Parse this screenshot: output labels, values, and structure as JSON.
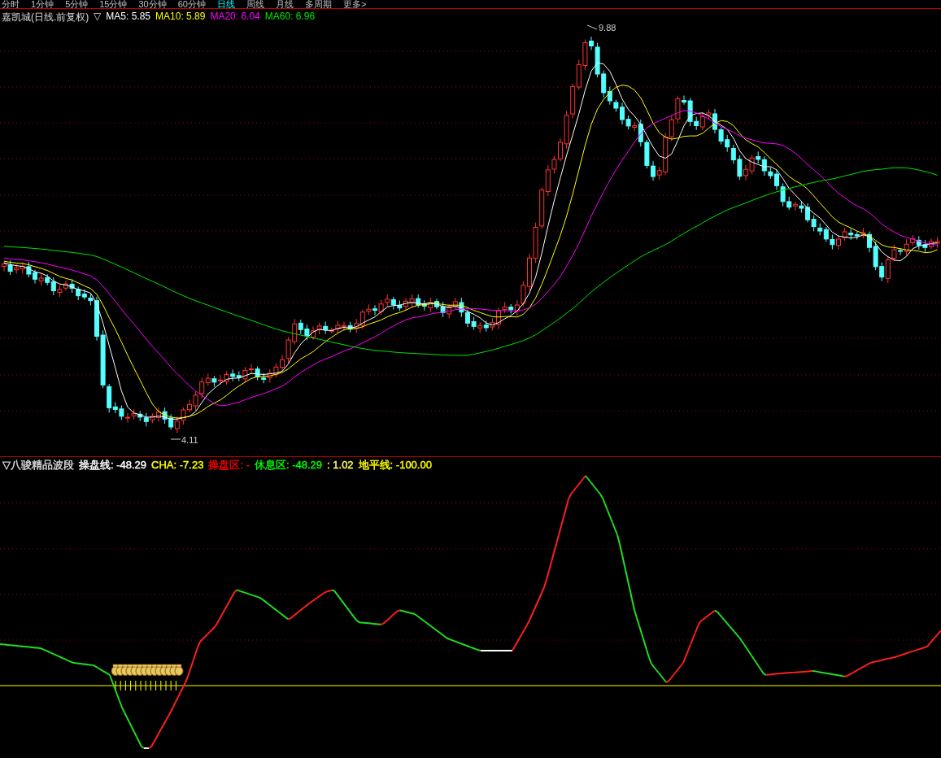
{
  "menu": {
    "items": [
      {
        "label": "分时",
        "selected": false
      },
      {
        "label": "1分钟",
        "selected": false
      },
      {
        "label": "5分钟",
        "selected": false
      },
      {
        "label": "15分钟",
        "selected": false
      },
      {
        "label": "30分钟",
        "selected": false
      },
      {
        "label": "60分钟",
        "selected": false
      },
      {
        "label": "日线",
        "selected": true
      },
      {
        "label": "周线",
        "selected": false
      },
      {
        "label": "月线",
        "selected": false
      },
      {
        "label": "多周期",
        "selected": false
      },
      {
        "label": "更多>",
        "selected": false
      }
    ]
  },
  "price_panel": {
    "title": "嘉凯城(日线.前复权)",
    "toggle": "▽",
    "legend": [
      {
        "label": "MA5: 5.85",
        "color": "#ffffff"
      },
      {
        "label": "MA10: 5.89",
        "color": "#ffff00"
      },
      {
        "label": "MA20: 6.04",
        "color": "#ff00ff"
      },
      {
        "label": "MA60: 6.96",
        "color": "#00e600"
      }
    ],
    "high_label": "9.88",
    "low_label": "4.11"
  },
  "indicator_panel": {
    "toggle": "▽",
    "title": "八骏精品波段",
    "legend": [
      {
        "label": "操盘线: -48.29",
        "color": "#ffffff"
      },
      {
        "label": "CHA: -7.23",
        "color": "#ffff00"
      },
      {
        "label": "操盘区: -",
        "color": "#ff0000"
      },
      {
        "label": "休息区: -48.29",
        "color": "#00ff00"
      },
      {
        "label": ": 1.02",
        "color": "#ffff66"
      },
      {
        "label": "地平线: -100.00",
        "color": "#ffff00"
      }
    ]
  }
}
